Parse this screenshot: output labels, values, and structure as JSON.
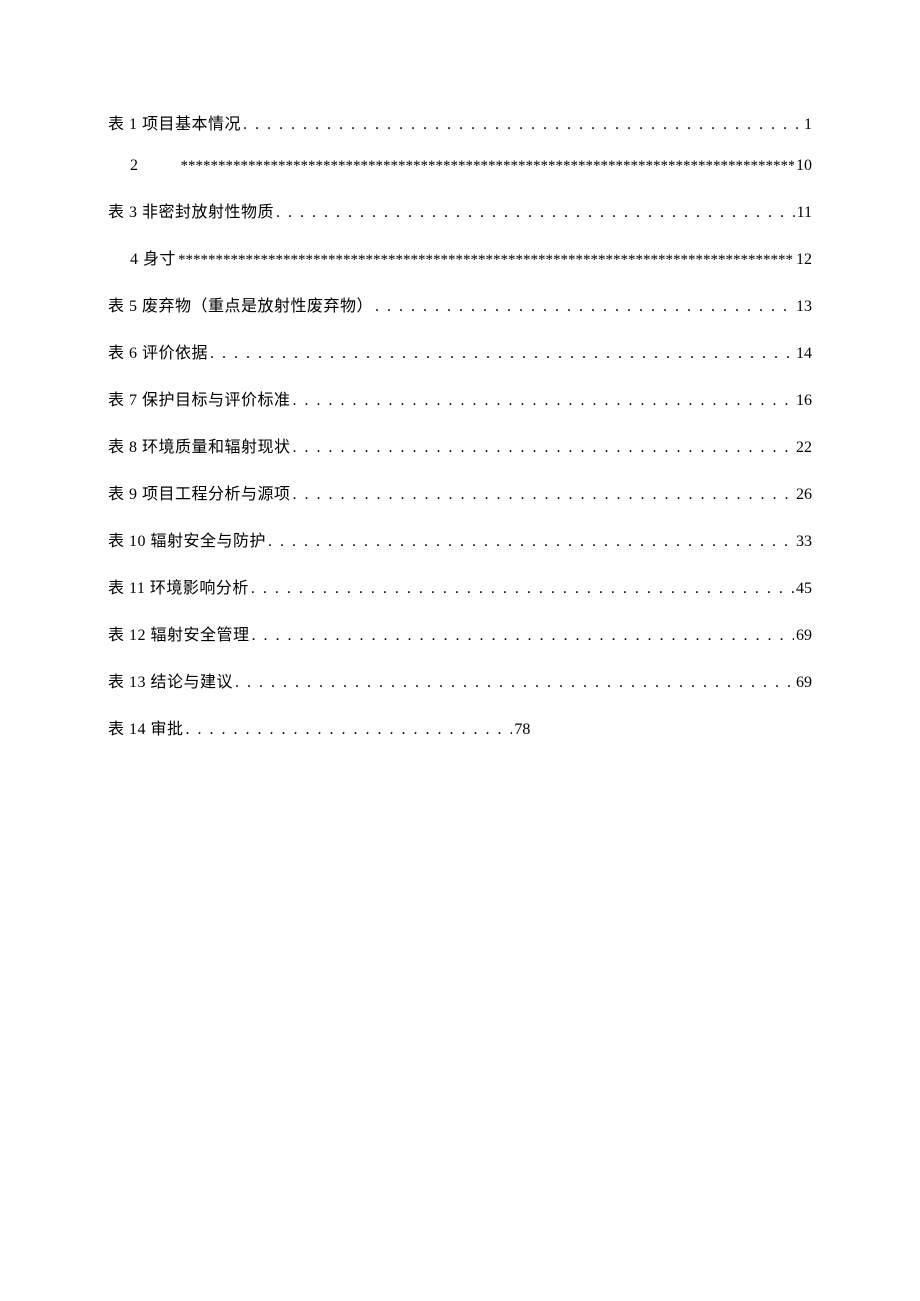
{
  "toc": {
    "entries": [
      {
        "title": "表 1 项目基本情况",
        "page": "1",
        "leader": "dot",
        "indent": false
      },
      {
        "title": "2",
        "page": "10",
        "leader": "star",
        "indent": true
      },
      {
        "title": "表 3 非密封放射性物质",
        "page": "11",
        "leader": "dot",
        "indent": false
      },
      {
        "title": "4 身寸",
        "page": "12",
        "leader": "star",
        "indent": true
      },
      {
        "title": "表 5 废弃物（重点是放射性废弃物）",
        "page": "13",
        "leader": "dot",
        "indent": false
      },
      {
        "title": "表 6 评价依据",
        "page": "14",
        "leader": "dot",
        "indent": false
      },
      {
        "title": "表 7 保护目标与评价标准",
        "page": "16",
        "leader": "dot",
        "indent": false
      },
      {
        "title": "表 8 环境质量和辐射现状",
        "page": "22",
        "leader": "dot",
        "indent": false
      },
      {
        "title": "表 9 项目工程分析与源项",
        "page": "26",
        "leader": "dot",
        "indent": false
      },
      {
        "title": "表 10 辐射安全与防护",
        "page": "33",
        "leader": "dot",
        "indent": false
      },
      {
        "title": "表 11 环境影响分析",
        "page": "45",
        "leader": "dot",
        "indent": false
      },
      {
        "title": "表 12 辐射安全管理",
        "page": "69",
        "leader": "dot",
        "indent": false
      },
      {
        "title": "表 13 结论与建议",
        "page": "69",
        "leader": "dot",
        "indent": false
      },
      {
        "title": "表 14 审批",
        "page": "78",
        "leader": "dot",
        "indent": false,
        "short": true
      }
    ]
  },
  "leaders": {
    "dot": ". . . . . . . . . . . . . . . . . . . . . . . . . . . . . . . . . . . . . . . . . . . . . . . . . . . . . . . . . . . . . . . . . . . . . . . . . . . . . . . . . . . . . . . . . . . . . . . . . . . . . . . . . . . . . . . . . . . . . . . . . . . . . . . . . . . . . . . . . . . .",
    "star": "************************************************************************************************************************"
  }
}
